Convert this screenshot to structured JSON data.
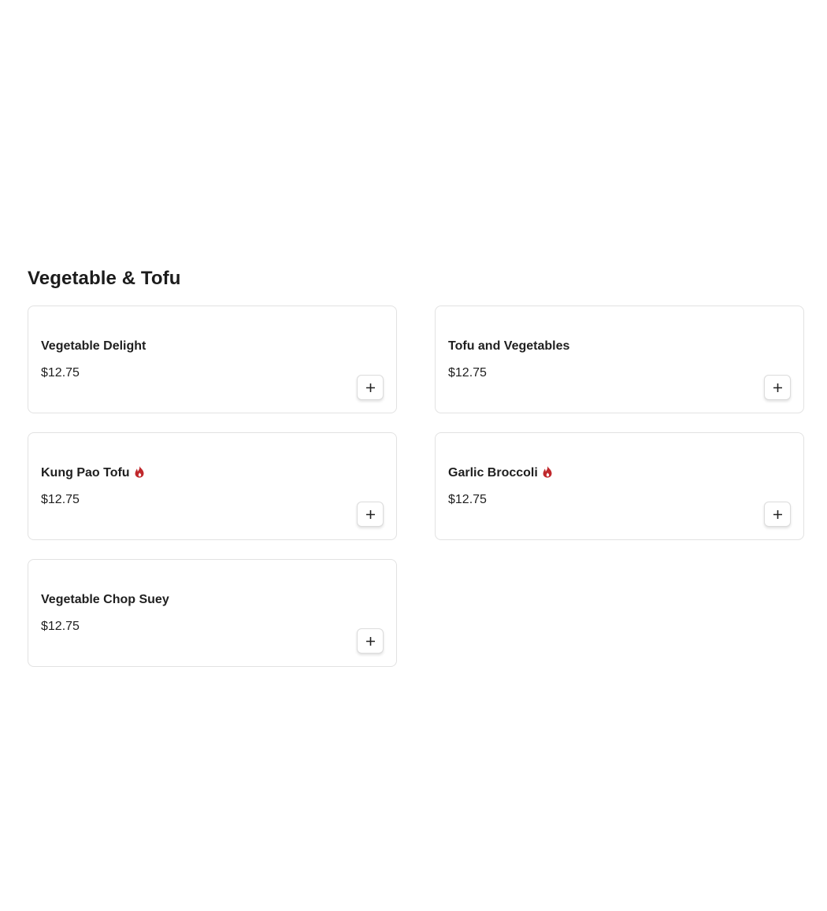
{
  "section": {
    "title": "Vegetable & Tofu"
  },
  "colors": {
    "spicy_icon": "#c0282c",
    "card_border": "#e2e2e2",
    "text": "#1f1f1f"
  },
  "items": [
    {
      "name": "Vegetable Delight",
      "price": "$12.75",
      "spicy": false,
      "add_icon": "plus-icon"
    },
    {
      "name": "Tofu and Vegetables",
      "price": "$12.75",
      "spicy": false,
      "add_icon": "plus-icon"
    },
    {
      "name": "Kung Pao Tofu",
      "price": "$12.75",
      "spicy": true,
      "add_icon": "plus-icon"
    },
    {
      "name": "Garlic Broccoli",
      "price": "$12.75",
      "spicy": true,
      "add_icon": "plus-icon"
    },
    {
      "name": "Vegetable Chop Suey",
      "price": "$12.75",
      "spicy": false,
      "add_icon": "plus-icon"
    }
  ]
}
